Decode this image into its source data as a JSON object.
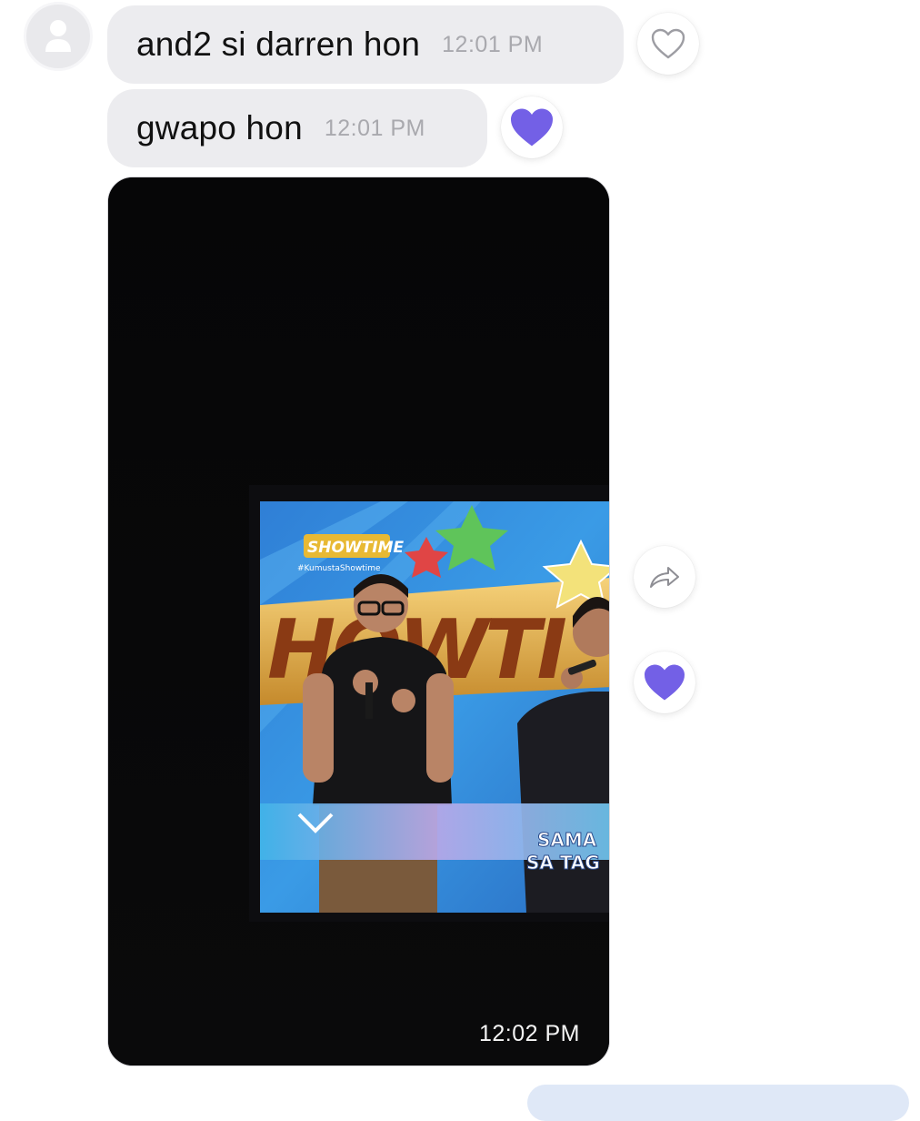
{
  "messages": [
    {
      "text": "and2 si darren hon",
      "time": "12:01 PM",
      "reaction": "heart-outline"
    },
    {
      "text": "gwapo hon",
      "time": "12:01 PM",
      "reaction": "heart-filled"
    }
  ],
  "media_message": {
    "time": "12:02 PM",
    "reaction": "heart-filled",
    "tv_caption_1": "SAMA",
    "tv_caption_2": "SA TAG",
    "tv_logo": "SHOWTIME",
    "tv_hashtag": "#KumustaShowtime",
    "tv_backdrop_text": "HOWTI"
  },
  "colors": {
    "incoming_bubble": "#ececef",
    "reaction_heart": "#7360e6",
    "timestamp": "#a9a9ae",
    "outgoing_bubble": "#dfe8f7"
  },
  "icons": [
    "user-avatar-icon",
    "heart-outline-icon",
    "heart-filled-icon",
    "share-arrow-icon"
  ]
}
